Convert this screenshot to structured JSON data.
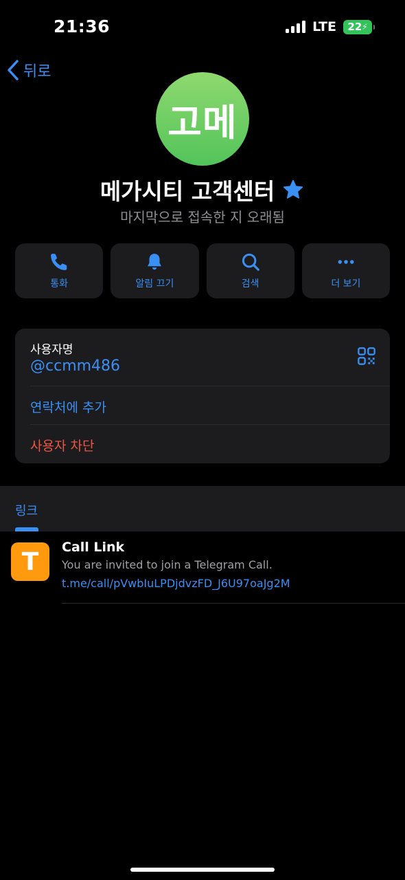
{
  "status": {
    "time": "21:36",
    "network": "LTE",
    "battery": "22"
  },
  "nav": {
    "back_label": "뒤로"
  },
  "profile": {
    "avatar_text": "고메",
    "name": "메가시티 고객센터",
    "last_seen": "마지막으로 접속한 지 오래됨"
  },
  "actions": [
    {
      "label": "통화",
      "icon": "phone-icon"
    },
    {
      "label": "알림 끄기",
      "icon": "bell-icon"
    },
    {
      "label": "검색",
      "icon": "search-icon"
    },
    {
      "label": "더 보기",
      "icon": "more-icon"
    }
  ],
  "info": {
    "username_title": "사용자명",
    "username": "@ccmm486",
    "add_contact": "연락처에 추가",
    "block_user": "사용자 차단"
  },
  "links": {
    "tab_label": "링크",
    "items": [
      {
        "thumb": "T",
        "title": "Call Link",
        "description": "You are invited to join a Telegram Call.",
        "url": "t.me/call/pVwbIuLPDjdvzFD_J6U97oaJg2M"
      }
    ]
  },
  "colors": {
    "accent": "#3a8ff5",
    "danger": "#eb5545",
    "card": "#1c1c1e",
    "avatar": "#52c45a",
    "thumb": "#ff9a0f"
  }
}
